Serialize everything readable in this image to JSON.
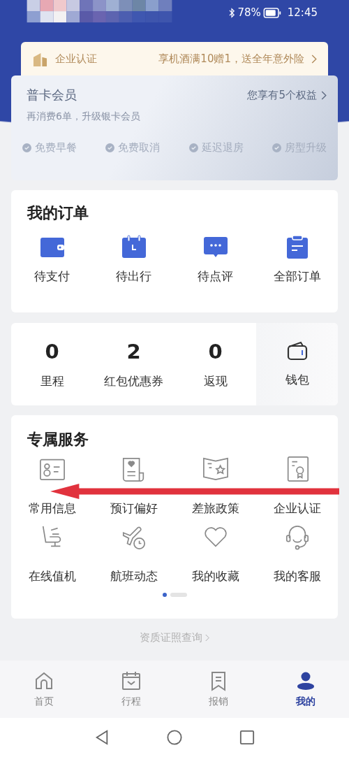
{
  "status_bar": {
    "battery": "78%",
    "time": "12:45"
  },
  "enterprise_banner": {
    "label": "企业认证",
    "promo": "享机酒满10赠1，送全年意外险"
  },
  "membership": {
    "tier": "普卡会员",
    "benefits_link": "您享有5个权益",
    "progress": "再消费6单，升级银卡会员",
    "perks": [
      "免费早餐",
      "免费取消",
      "延迟退房",
      "房型升级"
    ]
  },
  "orders": {
    "title": "我的订单",
    "items": [
      {
        "label": "待支付",
        "kind": "wallet"
      },
      {
        "label": "待出行",
        "kind": "calendar"
      },
      {
        "label": "待点评",
        "kind": "comment"
      },
      {
        "label": "全部订单",
        "kind": "clipboard"
      }
    ]
  },
  "stats": {
    "items": [
      {
        "value": "0",
        "label": "里程"
      },
      {
        "value": "2",
        "label": "红包优惠券"
      },
      {
        "value": "0",
        "label": "返现"
      }
    ],
    "wallet": {
      "label": "钱包"
    }
  },
  "services": {
    "title": "专属服务",
    "items": [
      {
        "label": "常用信息",
        "kind": "id-card"
      },
      {
        "label": "预订偏好",
        "kind": "document-heart"
      },
      {
        "label": "差旅政策",
        "kind": "map-star"
      },
      {
        "label": "企业认证",
        "kind": "certificate"
      },
      {
        "label": "在线值机",
        "kind": "seat"
      },
      {
        "label": "航班动态",
        "kind": "plane-clock"
      },
      {
        "label": "我的收藏",
        "kind": "heart"
      },
      {
        "label": "我的客服",
        "kind": "headset"
      }
    ],
    "pager": [
      {
        "selected": true
      },
      {
        "selected": false
      }
    ]
  },
  "footer_link": "资质证照查询",
  "tab_bar": [
    {
      "label": "首页",
      "kind": "home",
      "selected": false
    },
    {
      "label": "行程",
      "kind": "calendar",
      "selected": false
    },
    {
      "label": "报销",
      "kind": "receipt",
      "selected": false
    },
    {
      "label": "我的",
      "kind": "person",
      "selected": true
    }
  ],
  "annotation": {
    "kind": "arrow"
  }
}
